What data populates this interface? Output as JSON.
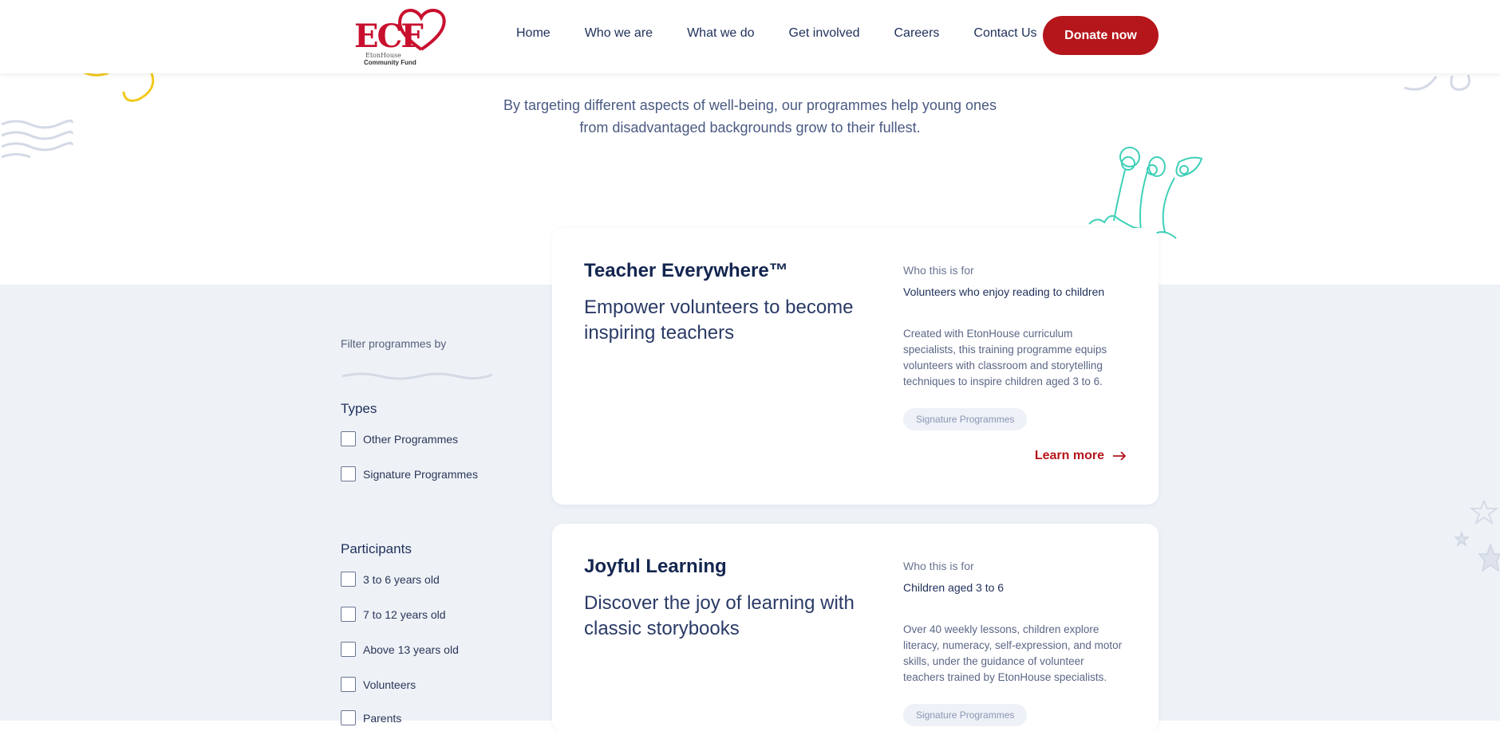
{
  "header": {
    "logo": {
      "text": "ECF",
      "sub1": "EtonHouse",
      "sub2": "Community Fund"
    },
    "nav": [
      "Home",
      "Who we are",
      "What we do",
      "Get involved",
      "Careers",
      "Contact Us"
    ],
    "donate_label": "Donate now"
  },
  "intro": {
    "line1": "By targeting different aspects of well-being, our programmes help young ones",
    "line2": "from disadvantaged backgrounds grow to their fullest."
  },
  "filters": {
    "title": "Filter programmes by",
    "types": {
      "title": "Types",
      "options": [
        "Other Programmes",
        "Signature Programmes"
      ]
    },
    "participants": {
      "title": "Participants",
      "options": [
        "3 to 6 years old",
        "7 to 12 years old",
        "Above 13 years old",
        "Volunteers",
        "Parents"
      ]
    }
  },
  "programmes": [
    {
      "title": "Teacher Everywhere™",
      "tagline": "Empower volunteers to become inspiring teachers",
      "who_label": "Who this is for",
      "who": "Volunteers who enjoy reading to children",
      "description": "Created with EtonHouse curriculum specialists, this training programme equips volunteers with classroom and storytelling techniques to inspire children aged 3 to 6.",
      "chip": "Signature Programmes",
      "learn_more": "Learn more"
    },
    {
      "title": "Joyful Learning",
      "tagline": "Discover the joy of learning with classic storybooks",
      "who_label": "Who this is for",
      "who": "Children aged 3 to 6",
      "description": "Over 40 weekly lessons, children explore literacy, numeracy, self-expression, and motor skills, under the guidance of volunteer teachers trained by EtonHouse specialists.",
      "chip": "Signature Programmes"
    }
  ],
  "colors": {
    "accent": "#b5161b",
    "navy": "#1f2f5a",
    "band": "#eef2f7",
    "doodle_teal": "#3fd0b8",
    "doodle_yellow": "#f2c91b"
  }
}
